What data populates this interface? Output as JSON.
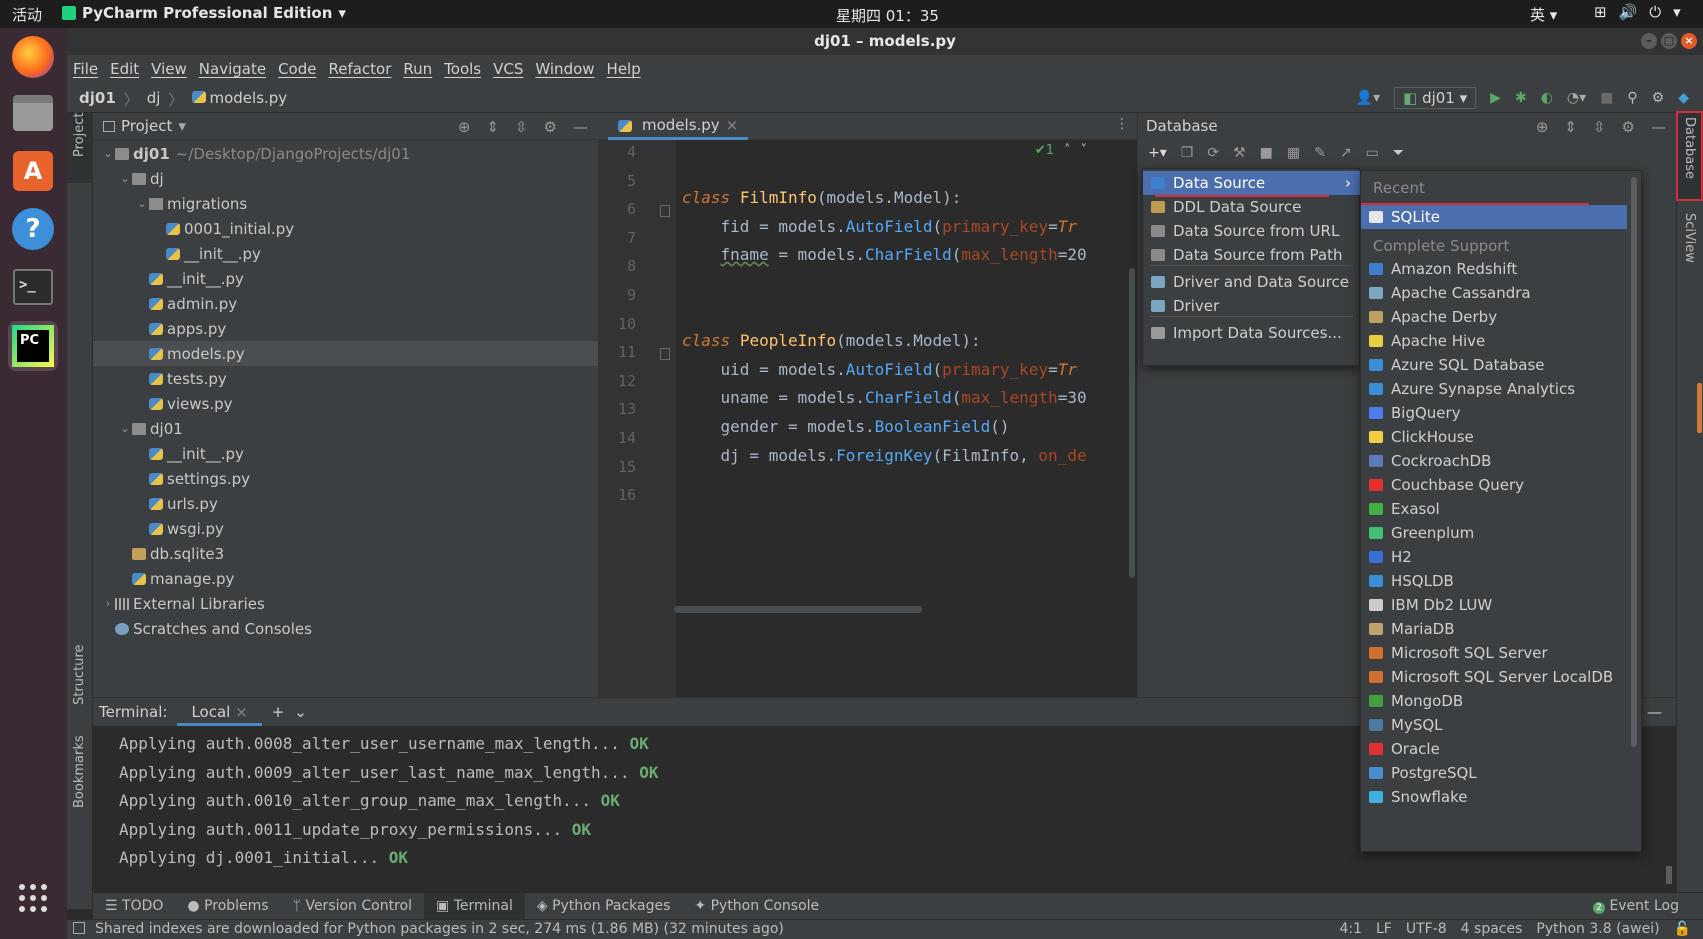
{
  "system": {
    "activities": "活动",
    "app_menu": "PyCharm Professional Edition",
    "clock": "星期四 01：35",
    "input_method": "英"
  },
  "window": {
    "title": "dj01 – models.py"
  },
  "menubar": [
    "File",
    "Edit",
    "View",
    "Navigate",
    "Code",
    "Refactor",
    "Run",
    "Tools",
    "VCS",
    "Window",
    "Help"
  ],
  "breadcrumb": [
    "dj01",
    "dj",
    "models.py"
  ],
  "run_config": "dj01",
  "left_strip": {
    "project": "Project",
    "structure": "Structure",
    "bookmarks": "Bookmarks"
  },
  "right_strip": {
    "database": "Database",
    "sciview": "SciView"
  },
  "project": {
    "title": "Project",
    "tree": [
      {
        "label": "dj01",
        "path": "~/Desktop/DjangoProjects/dj01",
        "type": "folder",
        "depth": 0,
        "expanded": true
      },
      {
        "label": "dj",
        "type": "folder",
        "depth": 1,
        "expanded": true
      },
      {
        "label": "migrations",
        "type": "folder",
        "depth": 2,
        "expanded": true
      },
      {
        "label": "0001_initial.py",
        "type": "py",
        "depth": 3
      },
      {
        "label": "__init__.py",
        "type": "py",
        "depth": 3
      },
      {
        "label": "__init__.py",
        "type": "py",
        "depth": 2
      },
      {
        "label": "admin.py",
        "type": "py",
        "depth": 2
      },
      {
        "label": "apps.py",
        "type": "py",
        "depth": 2
      },
      {
        "label": "models.py",
        "type": "py",
        "depth": 2,
        "selected": true
      },
      {
        "label": "tests.py",
        "type": "py",
        "depth": 2
      },
      {
        "label": "views.py",
        "type": "py",
        "depth": 2
      },
      {
        "label": "dj01",
        "type": "folder",
        "depth": 1,
        "expanded": true
      },
      {
        "label": "__init__.py",
        "type": "py",
        "depth": 2
      },
      {
        "label": "settings.py",
        "type": "py",
        "depth": 2
      },
      {
        "label": "urls.py",
        "type": "py",
        "depth": 2
      },
      {
        "label": "wsgi.py",
        "type": "py",
        "depth": 2
      },
      {
        "label": "db.sqlite3",
        "type": "db",
        "depth": 1
      },
      {
        "label": "manage.py",
        "type": "py",
        "depth": 1
      },
      {
        "label": "External Libraries",
        "type": "lib",
        "depth": 0,
        "collapsed": true
      },
      {
        "label": "Scratches and Consoles",
        "type": "scratch",
        "depth": 0
      }
    ]
  },
  "editor": {
    "tab": "models.py",
    "inspection_count": "1",
    "line_numbers": [
      "4",
      "5",
      "6",
      "7",
      "8",
      "9",
      "10",
      "11",
      "12",
      "13",
      "14",
      "15",
      "16"
    ]
  },
  "database": {
    "title": "Database",
    "add_menu": [
      "Data Source",
      "DDL Data Source",
      "Data Source from URL",
      "Data Source from Path",
      "Driver and Data Source",
      "Driver",
      "Import Data Sources..."
    ],
    "recent_header": "Recent",
    "recent": [
      "SQLite"
    ],
    "complete_header": "Complete Support",
    "complete": [
      "Amazon Redshift",
      "Apache Cassandra",
      "Apache Derby",
      "Apache Hive",
      "Azure SQL Database",
      "Azure Synapse Analytics",
      "BigQuery",
      "ClickHouse",
      "CockroachDB",
      "Couchbase Query",
      "Exasol",
      "Greenplum",
      "H2",
      "HSQLDB",
      "IBM Db2 LUW",
      "MariaDB",
      "Microsoft SQL Server",
      "Microsoft SQL Server LocalDB",
      "MongoDB",
      "MySQL",
      "Oracle",
      "PostgreSQL",
      "Snowflake"
    ],
    "icon_colors": [
      "#3f7fd0",
      "#7aa6c2",
      "#c0a060",
      "#e8d040",
      "#3a8fd6",
      "#3a8fd6",
      "#4a7cf0",
      "#f0d040",
      "#5a7ab8",
      "#e03030",
      "#40b040",
      "#40c070",
      "#3a6fd8",
      "#3a8fd6",
      "#cccccc",
      "#c0a070",
      "#d07030",
      "#d07030",
      "#40a040",
      "#4a7aa0",
      "#e03030",
      "#4a8ad0",
      "#40b0e0"
    ]
  },
  "terminal": {
    "label": "Terminal:",
    "tab": "Local",
    "lines": [
      {
        "text": "Applying auth.0008_alter_user_username_max_length...",
        "status": "OK"
      },
      {
        "text": "Applying auth.0009_alter_user_last_name_max_length...",
        "status": "OK"
      },
      {
        "text": "Applying auth.0010_alter_group_name_max_length...",
        "status": "OK"
      },
      {
        "text": "Applying auth.0011_update_proxy_permissions...",
        "status": "OK"
      },
      {
        "text": "Applying dj.0001_initial...",
        "status": "OK"
      }
    ]
  },
  "bottom_tools": [
    "TODO",
    "Problems",
    "Version Control",
    "Terminal",
    "Python Packages",
    "Python Console"
  ],
  "event_log": {
    "count": "2",
    "label": "Event Log"
  },
  "status": {
    "message": "Shared indexes are downloaded for Python packages in 2 sec, 274 ms (1.86 MB) (32 minutes ago)",
    "position": "4:1",
    "line_sep": "LF",
    "encoding": "UTF-8",
    "indent": "4 spaces",
    "interpreter": "Python 3.8 (awei)"
  },
  "colors": {
    "accent": "#4b6eaf",
    "highlight_box": "#d0303a",
    "ok": "#6aab73"
  }
}
